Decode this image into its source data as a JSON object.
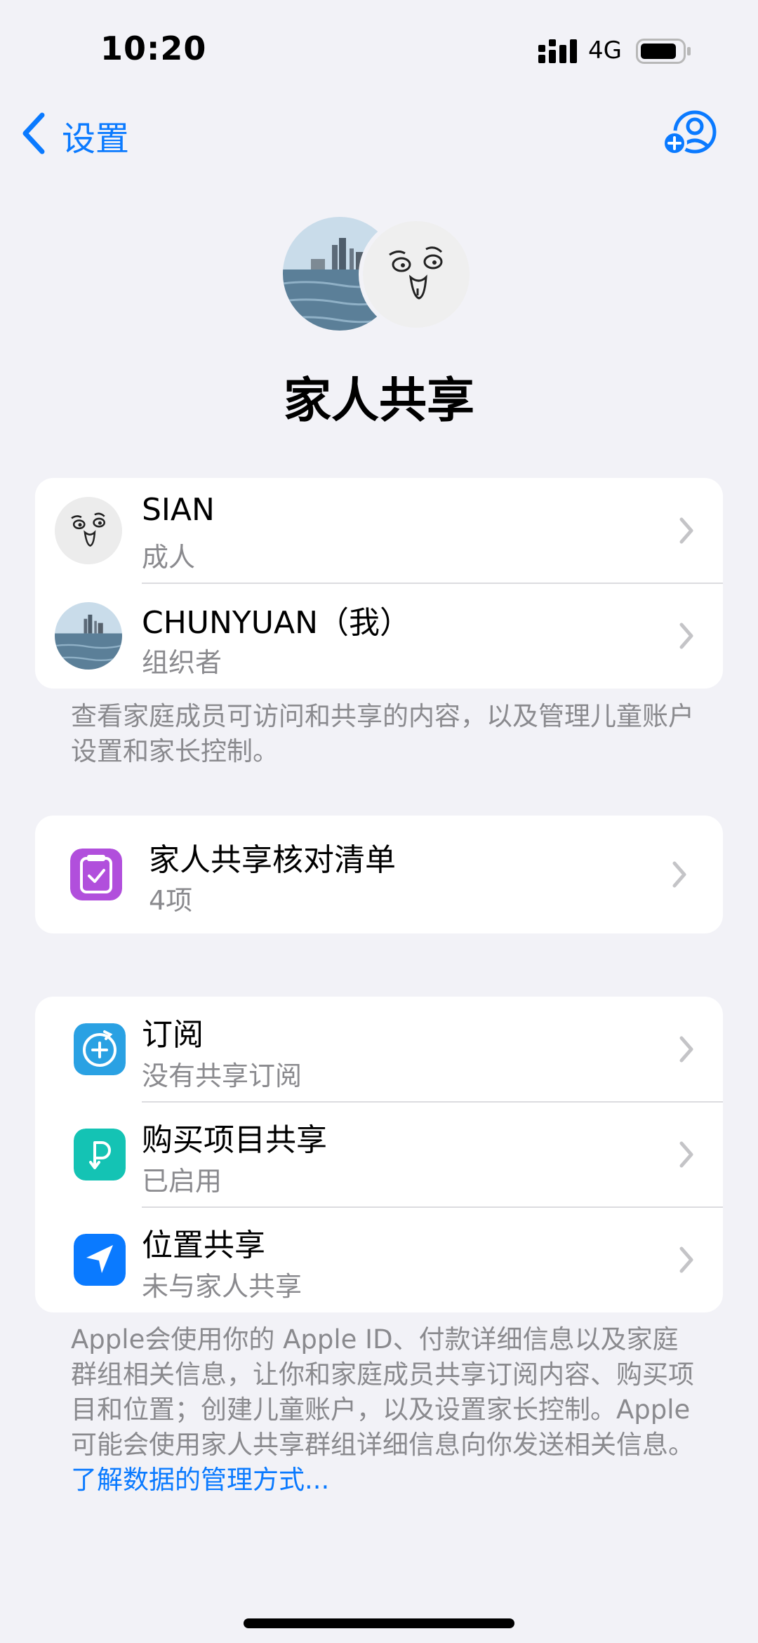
{
  "status": {
    "time": "10:20",
    "network": "4G"
  },
  "nav": {
    "back_label": "设置"
  },
  "title": "家人共享",
  "members": [
    {
      "name": "SIAN",
      "role": "成人"
    },
    {
      "name": "CHUNYUAN（我）",
      "role": "组织者"
    }
  ],
  "members_footer": "查看家庭成员可访问和共享的内容，以及管理儿童账户设置和家长控制。",
  "checklist": {
    "title": "家人共享核对清单",
    "subtitle": "4项"
  },
  "features": [
    {
      "title": "订阅",
      "subtitle": "没有共享订阅"
    },
    {
      "title": "购买项目共享",
      "subtitle": "已启用"
    },
    {
      "title": "位置共享",
      "subtitle": "未与家人共享"
    }
  ],
  "footer_text": "Apple会使用你的 Apple ID、付款详细信息以及家庭群组相关信息，让你和家庭成员共享订阅内容、购买项目和位置；创建儿童账户，以及设置家长控制。Apple 可能会使用家人共享群组详细信息向你发送相关信息。",
  "footer_link": "了解数据的管理方式...",
  "colors": {
    "accent": "#0a7aff",
    "checklist": "#b14fdc",
    "subscriptions": "#2aa1e3",
    "purchases": "#14c3b4",
    "location": "#0a7aff"
  }
}
